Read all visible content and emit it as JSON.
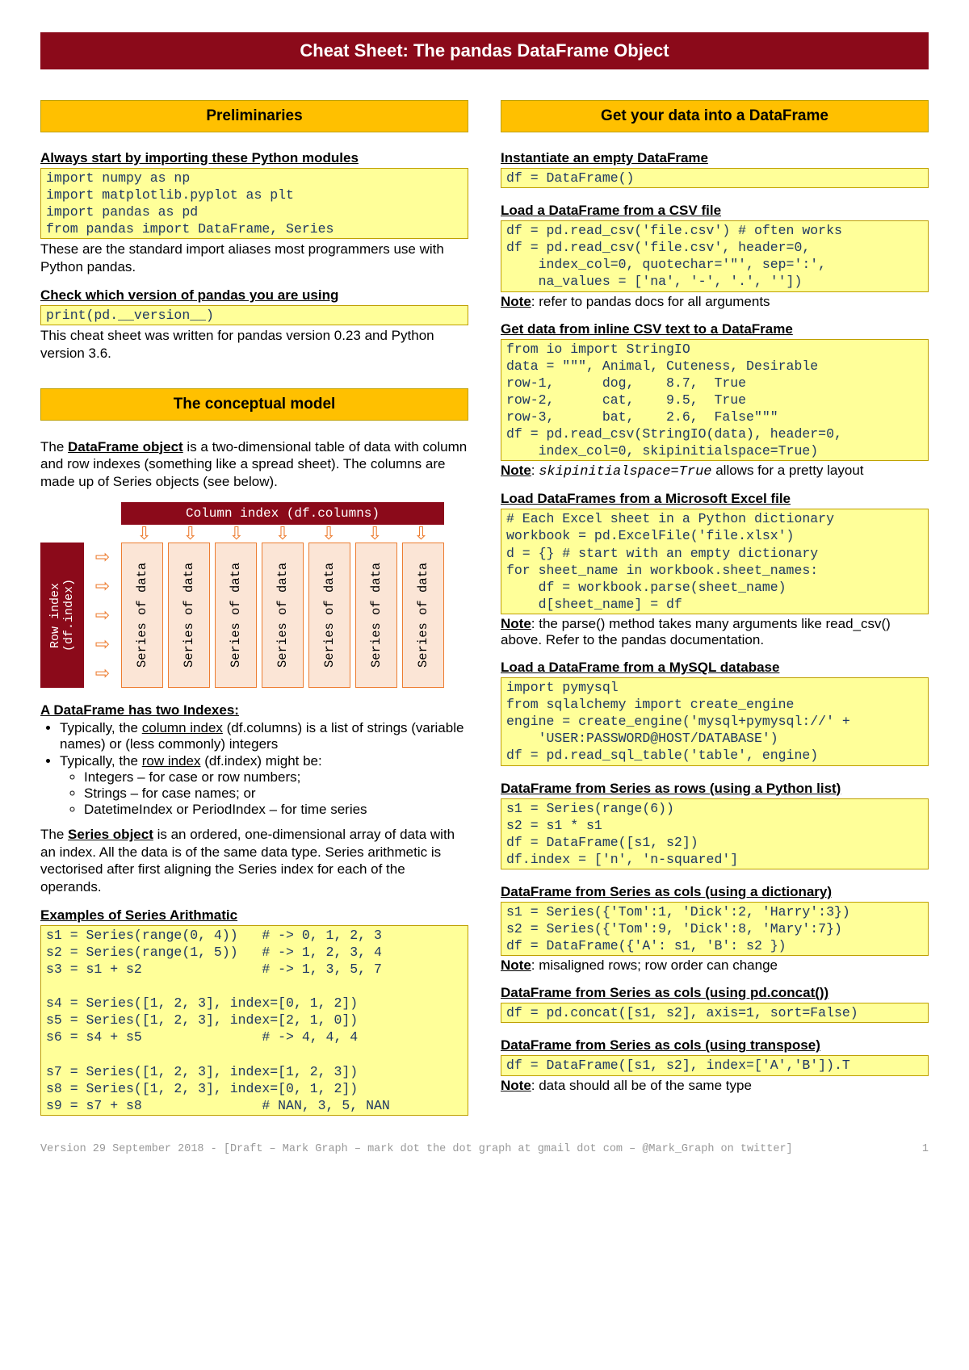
{
  "title": "Cheat Sheet: The pandas DataFrame Object",
  "left": {
    "sec1_title": "Preliminaries",
    "sub1": "Always start by importing these Python modules",
    "code1": "import numpy as np\nimport matplotlib.pyplot as plt\nimport pandas as pd\nfrom pandas import DataFrame, Series",
    "text1": "These are the standard import aliases most programmers use with Python pandas.",
    "sub2": "Check which version of pandas you are using",
    "code2": "print(pd.__version__)",
    "text2": "This cheat sheet was written for pandas version 0.23 and Python version 3.6.",
    "sec2_title": "The conceptual model",
    "text3_a": "The ",
    "text3_b": "DataFrame object",
    "text3_c": " is a two-dimensional table of data with column and row indexes (something like a spread sheet). The columns are made up of Series objects (see below).",
    "diagram_col_index": "Column index (df.columns)",
    "diagram_row_index": "Row index\n(df.index)",
    "diagram_series": "Series of data",
    "sub3": "A DataFrame has two Indexes:",
    "bul1_a": "Typically, the ",
    "bul1_b": "column index",
    "bul1_c": " (df.columns) is a list of strings (variable names) or (less commonly) integers",
    "bul2_a": "Typically, the ",
    "bul2_b": "row index",
    "bul2_c": " (df.index) might be:",
    "bul2_sub1": "Integers – for case or row numbers;",
    "bul2_sub2": "Strings – for case names; or",
    "bul2_sub3": "DatetimeIndex or PeriodIndex – for time series",
    "text4_a": "The ",
    "text4_b": "Series object",
    "text4_c": " is an ordered, one-dimensional array of data with an index. All the data is of the same data type. Series arithmetic is vectorised after first aligning the Series index for each of the operands.",
    "sub4": "Examples of Series Arithmatic",
    "code3": "s1 = Series(range(0, 4))   # -> 0, 1, 2, 3\ns2 = Series(range(1, 5))   # -> 1, 2, 3, 4\ns3 = s1 + s2               # -> 1, 3, 5, 7\n\ns4 = Series([1, 2, 3], index=[0, 1, 2])\ns5 = Series([1, 2, 3], index=[2, 1, 0])\ns6 = s4 + s5               # -> 4, 4, 4\n\ns7 = Series([1, 2, 3], index=[1, 2, 3])\ns8 = Series([1, 2, 3], index=[0, 1, 2])\ns9 = s7 + s8               # NAN, 3, 5, NAN"
  },
  "right": {
    "sec1_title": "Get your data into a DataFrame",
    "sub1": "Instantiate an empty DataFrame",
    "code1": "df = DataFrame()",
    "sub2": "Load a DataFrame from a CSV file",
    "code2": "df = pd.read_csv('file.csv') # often works\ndf = pd.read_csv('file.csv', header=0,\n    index_col=0, quotechar='\"', sep=':',\n    na_values = ['na', '-', '.', ''])",
    "note2_u": "Note",
    "note2": ": refer to pandas docs for all arguments",
    "sub3": "Get data from inline CSV text to a DataFrame",
    "code3": "from io import StringIO\ndata = \"\"\", Animal, Cuteness, Desirable\nrow-1,      dog,    8.7,  True\nrow-2,      cat,    9.5,  True\nrow-3,      bat,    2.6,  False\"\"\"\ndf = pd.read_csv(StringIO(data), header=0,\n    index_col=0, skipinitialspace=True)",
    "note3_u": "Note",
    "note3_a": ": ",
    "note3_m": "skipinitialspace=True",
    "note3_b": " allows for a pretty layout",
    "sub4": "Load DataFrames from a Microsoft Excel file",
    "code4": "# Each Excel sheet in a Python dictionary\nworkbook = pd.ExcelFile('file.xlsx')\nd = {} # start with an empty dictionary\nfor sheet_name in workbook.sheet_names:\n    df = workbook.parse(sheet_name)\n    d[sheet_name] = df",
    "note4_u": "Note",
    "note4": ": the parse() method takes many arguments like read_csv() above. Refer to the pandas documentation.",
    "sub5": "Load a DataFrame from a MySQL database",
    "code5": "import pymysql\nfrom sqlalchemy import create_engine\nengine = create_engine('mysql+pymysql://' +\n    'USER:PASSWORD@HOST/DATABASE')\ndf = pd.read_sql_table('table', engine)",
    "sub6": "DataFrame from Series as rows (using a Python list)",
    "code6": "s1 = Series(range(6))\ns2 = s1 * s1\ndf = DataFrame([s1, s2])\ndf.index = ['n', 'n-squared']",
    "sub7": "DataFrame from Series as cols (using a dictionary)",
    "code7": "s1 = Series({'Tom':1, 'Dick':2, 'Harry':3})\ns2 = Series({'Tom':9, 'Dick':8, 'Mary':7})\ndf = DataFrame({'A': s1, 'B': s2 })",
    "note7_u": "Note",
    "note7": ": misaligned rows; row order can change",
    "sub8": "DataFrame from Series as cols (using pd.concat())",
    "code8": "df = pd.concat([s1, s2], axis=1, sort=False)",
    "sub9": "DataFrame from Series as cols (using transpose)",
    "code9": "df = DataFrame([s1, s2], index=['A','B']).T",
    "note9_u": "Note",
    "note9": ": data should all be of the same type"
  },
  "footer_left": "Version 29 September 2018 - [Draft – Mark Graph – mark dot the dot graph at gmail dot com – @Mark_Graph on twitter]",
  "footer_right": "1"
}
